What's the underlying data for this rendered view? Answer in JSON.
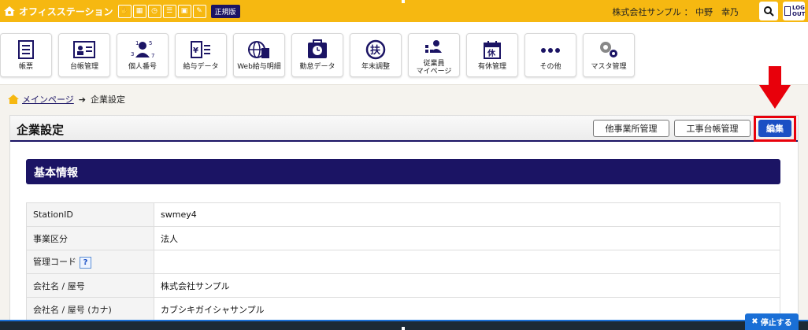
{
  "topbar": {
    "brand": "オフィスステーション",
    "plan": "正規版",
    "company": "株式会社サンプル",
    "separator": "：",
    "user": "中野　幸乃",
    "logout": "LOG OUT"
  },
  "nav": [
    {
      "label": "帳票",
      "icon": "document-icon"
    },
    {
      "label": "台帳管理",
      "icon": "ledger-icon"
    },
    {
      "label": "個人番号",
      "icon": "person-number-icon"
    },
    {
      "label": "給与データ",
      "icon": "salary-data-icon"
    },
    {
      "label": "Web給与明細",
      "icon": "web-payslip-icon"
    },
    {
      "label": "勤怠データ",
      "icon": "attendance-icon"
    },
    {
      "label": "年末調整",
      "icon": "year-end-icon"
    },
    {
      "label": "従業員\nマイページ",
      "icon": "employee-mypage-icon"
    },
    {
      "label": "有休管理",
      "icon": "paid-leave-icon"
    },
    {
      "label": "その他",
      "icon": "more-icon"
    },
    {
      "label": "マスタ管理",
      "icon": "master-gear-icon"
    }
  ],
  "breadcrumb": {
    "home": "メインページ",
    "current": "企業設定"
  },
  "panel": {
    "title": "企業設定",
    "btn_other_office": "他事業所管理",
    "btn_construction": "工事台帳管理",
    "btn_edit": "編集"
  },
  "section": {
    "title": "基本情報"
  },
  "rows": [
    {
      "key": "StationID",
      "value": "swmey4"
    },
    {
      "key": "事業区分",
      "value": "法人"
    },
    {
      "key": "管理コード",
      "value": "",
      "help": "?"
    },
    {
      "key": "会社名 / 屋号",
      "value": "株式会社サンプル"
    },
    {
      "key": "会社名 / 屋号 (カナ)",
      "value": "カブシキガイシャサンプル"
    }
  ],
  "stop_button": "停止する",
  "colors": {
    "topbar": "#f6b811",
    "navy": "#1b1464",
    "edit_blue": "#1a4fc4",
    "annotation_red": "#e8000b"
  }
}
